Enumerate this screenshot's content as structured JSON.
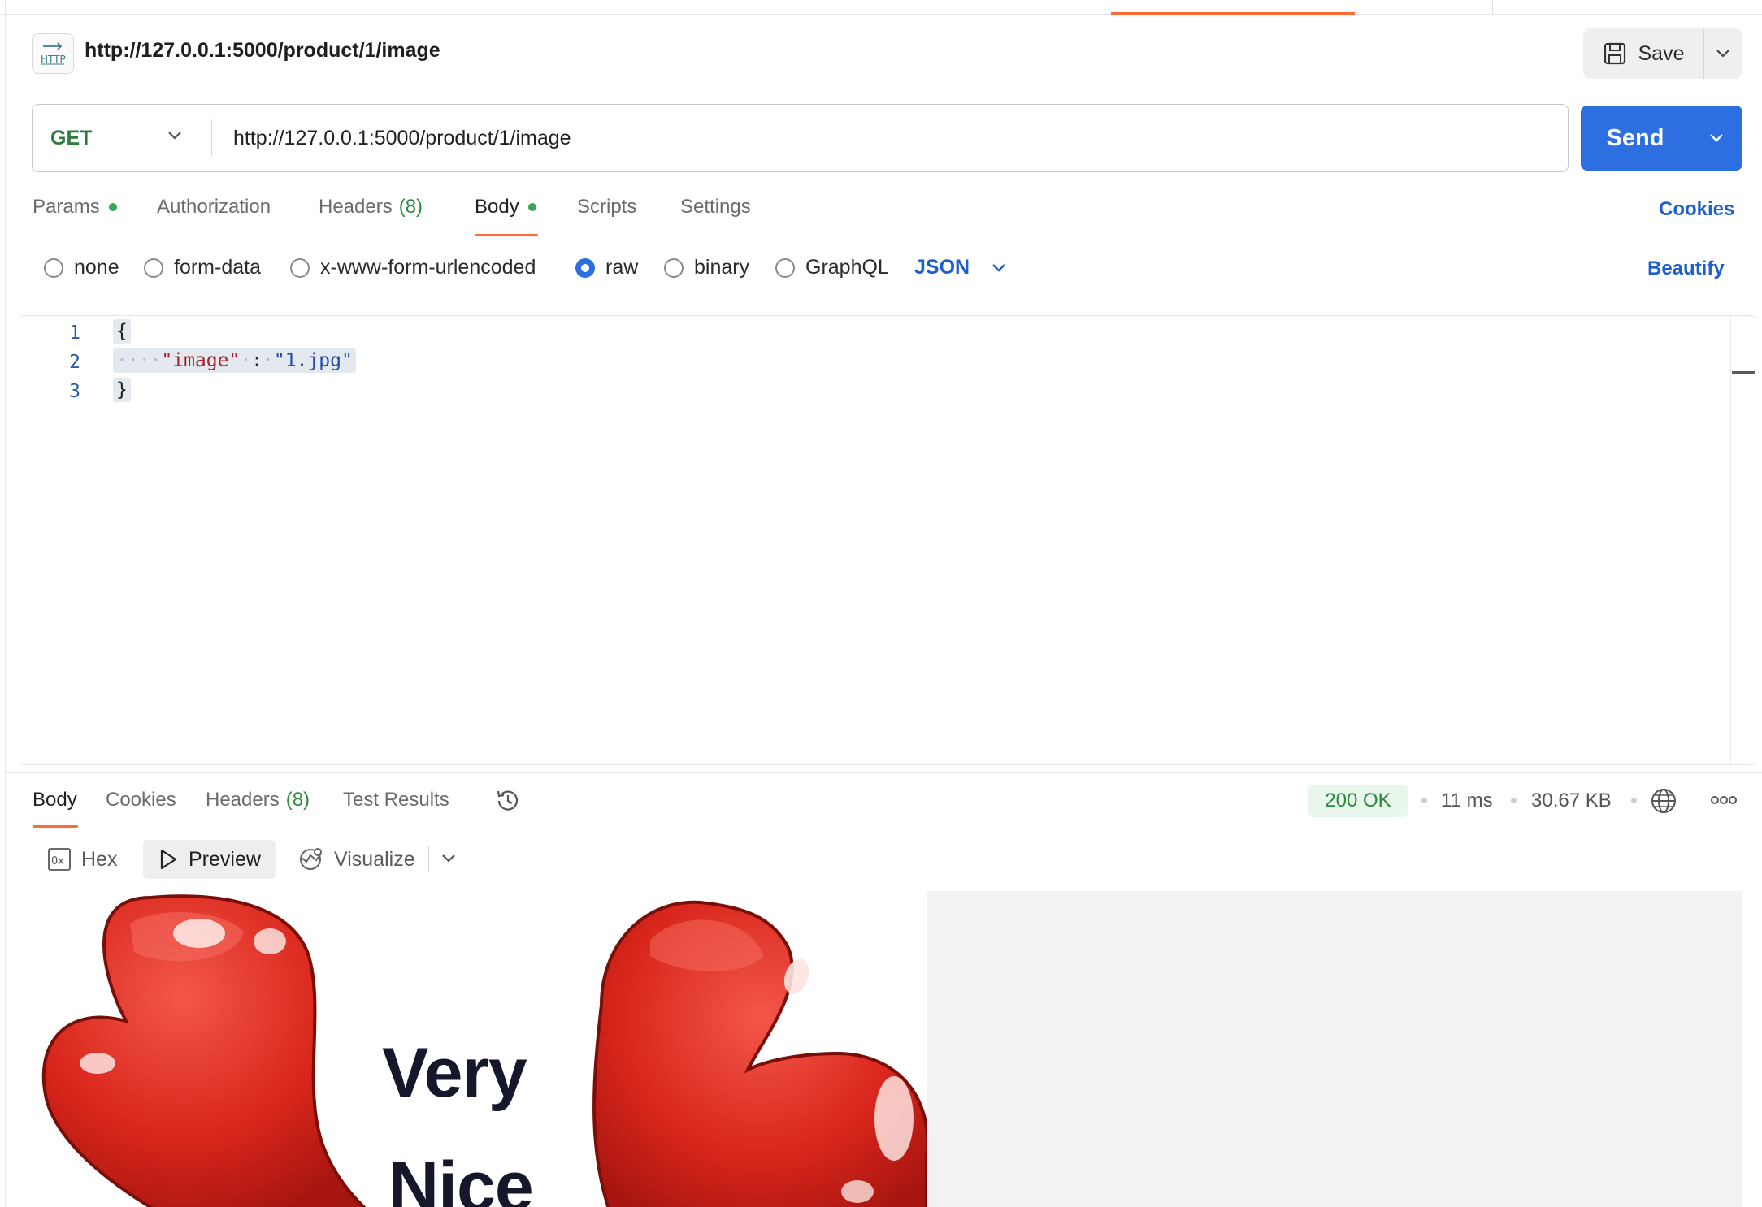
{
  "request": {
    "title": "http://127.0.0.1:5000/product/1/image",
    "method": "GET",
    "url": "http://127.0.0.1:5000/product/1/image",
    "save_label": "Save",
    "send_label": "Send"
  },
  "request_tabs": [
    {
      "label": "Params"
    },
    {
      "label": "Authorization"
    },
    {
      "label": "Headers",
      "count": "(8)"
    },
    {
      "label": "Body"
    },
    {
      "label": "Scripts"
    },
    {
      "label": "Settings"
    }
  ],
  "cookies_label": "Cookies",
  "body_types": [
    "none",
    "form-data",
    "x-www-form-urlencoded",
    "raw",
    "binary",
    "GraphQL"
  ],
  "body_language": "JSON",
  "beautify_label": "Beautify",
  "editor": {
    "line_numbers": [
      "1",
      "2",
      "3"
    ],
    "open_brace": "{",
    "key": "\"image\"",
    "colon": ":",
    "value": "\"1.jpg\"",
    "close_brace": "}"
  },
  "response_tabs": [
    {
      "label": "Body"
    },
    {
      "label": "Cookies"
    },
    {
      "label": "Headers",
      "count": "(8)"
    },
    {
      "label": "Test Results"
    }
  ],
  "response_meta": {
    "status": "200 OK",
    "time": "11 ms",
    "size": "30.67 KB"
  },
  "view_modes": [
    {
      "label": "Hex"
    },
    {
      "label": "Preview"
    },
    {
      "label": "Visualize"
    }
  ],
  "preview_image": {
    "word1": "Very",
    "word2": "Nice"
  },
  "colors": {
    "accent": "#ff6c37",
    "primary": "#2d6fe0",
    "link": "#1e5fcf",
    "method_get": "#2d7a3d",
    "status_ok": "#2b8a3e",
    "heart_red": "#d9261c"
  }
}
